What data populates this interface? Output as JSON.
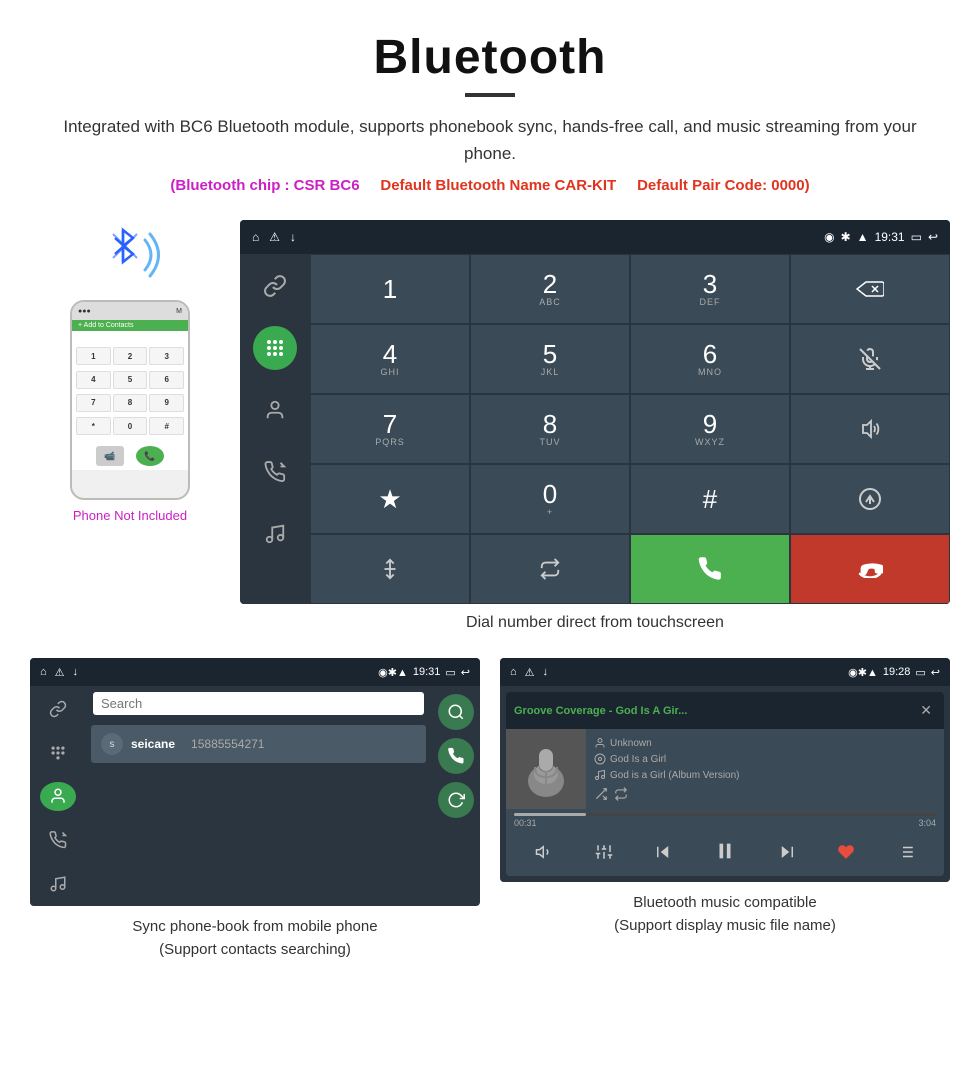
{
  "header": {
    "title": "Bluetooth",
    "description": "Integrated with BC6 Bluetooth module, supports phonebook sync, hands-free call, and music streaming from your phone.",
    "spec1": "(Bluetooth chip : CSR BC6",
    "spec2": "Default Bluetooth Name CAR-KIT",
    "spec3": "Default Pair Code: 0000)",
    "divider": "—"
  },
  "phone": {
    "not_included": "Phone Not Included",
    "add_contacts": "+ Add to Contacts"
  },
  "status_bar": {
    "time": "19:31",
    "left_icons": [
      "⌂",
      "⚠",
      "↓"
    ],
    "right_icons": [
      "◉",
      "✱",
      "▲",
      "19:31",
      "▭",
      "↩"
    ]
  },
  "dial_keys": [
    {
      "big": "1",
      "small": ""
    },
    {
      "big": "2",
      "small": "ABC"
    },
    {
      "big": "3",
      "small": "DEF"
    },
    {
      "big": "⌫",
      "small": ""
    },
    {
      "big": "4",
      "small": "GHI"
    },
    {
      "big": "5",
      "small": "JKL"
    },
    {
      "big": "6",
      "small": "MNO"
    },
    {
      "big": "🔇",
      "small": ""
    },
    {
      "big": "7",
      "small": "PQRS"
    },
    {
      "big": "8",
      "small": "TUV"
    },
    {
      "big": "9",
      "small": "WXYZ"
    },
    {
      "big": "🔊",
      "small": ""
    },
    {
      "big": "★",
      "small": ""
    },
    {
      "big": "0",
      "small": "+"
    },
    {
      "big": "#",
      "small": ""
    },
    {
      "big": "⇅",
      "small": ""
    },
    {
      "big": "⚹",
      "small": ""
    },
    {
      "big": "⇄",
      "small": ""
    },
    {
      "big": "📞",
      "small": ""
    },
    {
      "big": "📵",
      "small": ""
    }
  ],
  "dial_caption": "Dial number direct from touchscreen",
  "phonebook": {
    "search_placeholder": "Search",
    "contact_initial": "s",
    "contact_name": "seicane",
    "contact_number": "15885554271"
  },
  "music": {
    "title": "Groove Coverage - God Is A Gir...",
    "artist": "Unknown",
    "album": "God Is a Girl",
    "track": "God is a Girl (Album Version)",
    "time_current": "00:31",
    "time_total": "3:04",
    "progress_percent": 17
  },
  "bottom_status_left": {
    "time": "19:31"
  },
  "bottom_status_right": {
    "time": "19:28"
  },
  "captions": {
    "phonebook": "Sync phone-book from mobile phone\n(Support contacts searching)",
    "music": "Bluetooth music compatible\n(Support display music file name)"
  }
}
